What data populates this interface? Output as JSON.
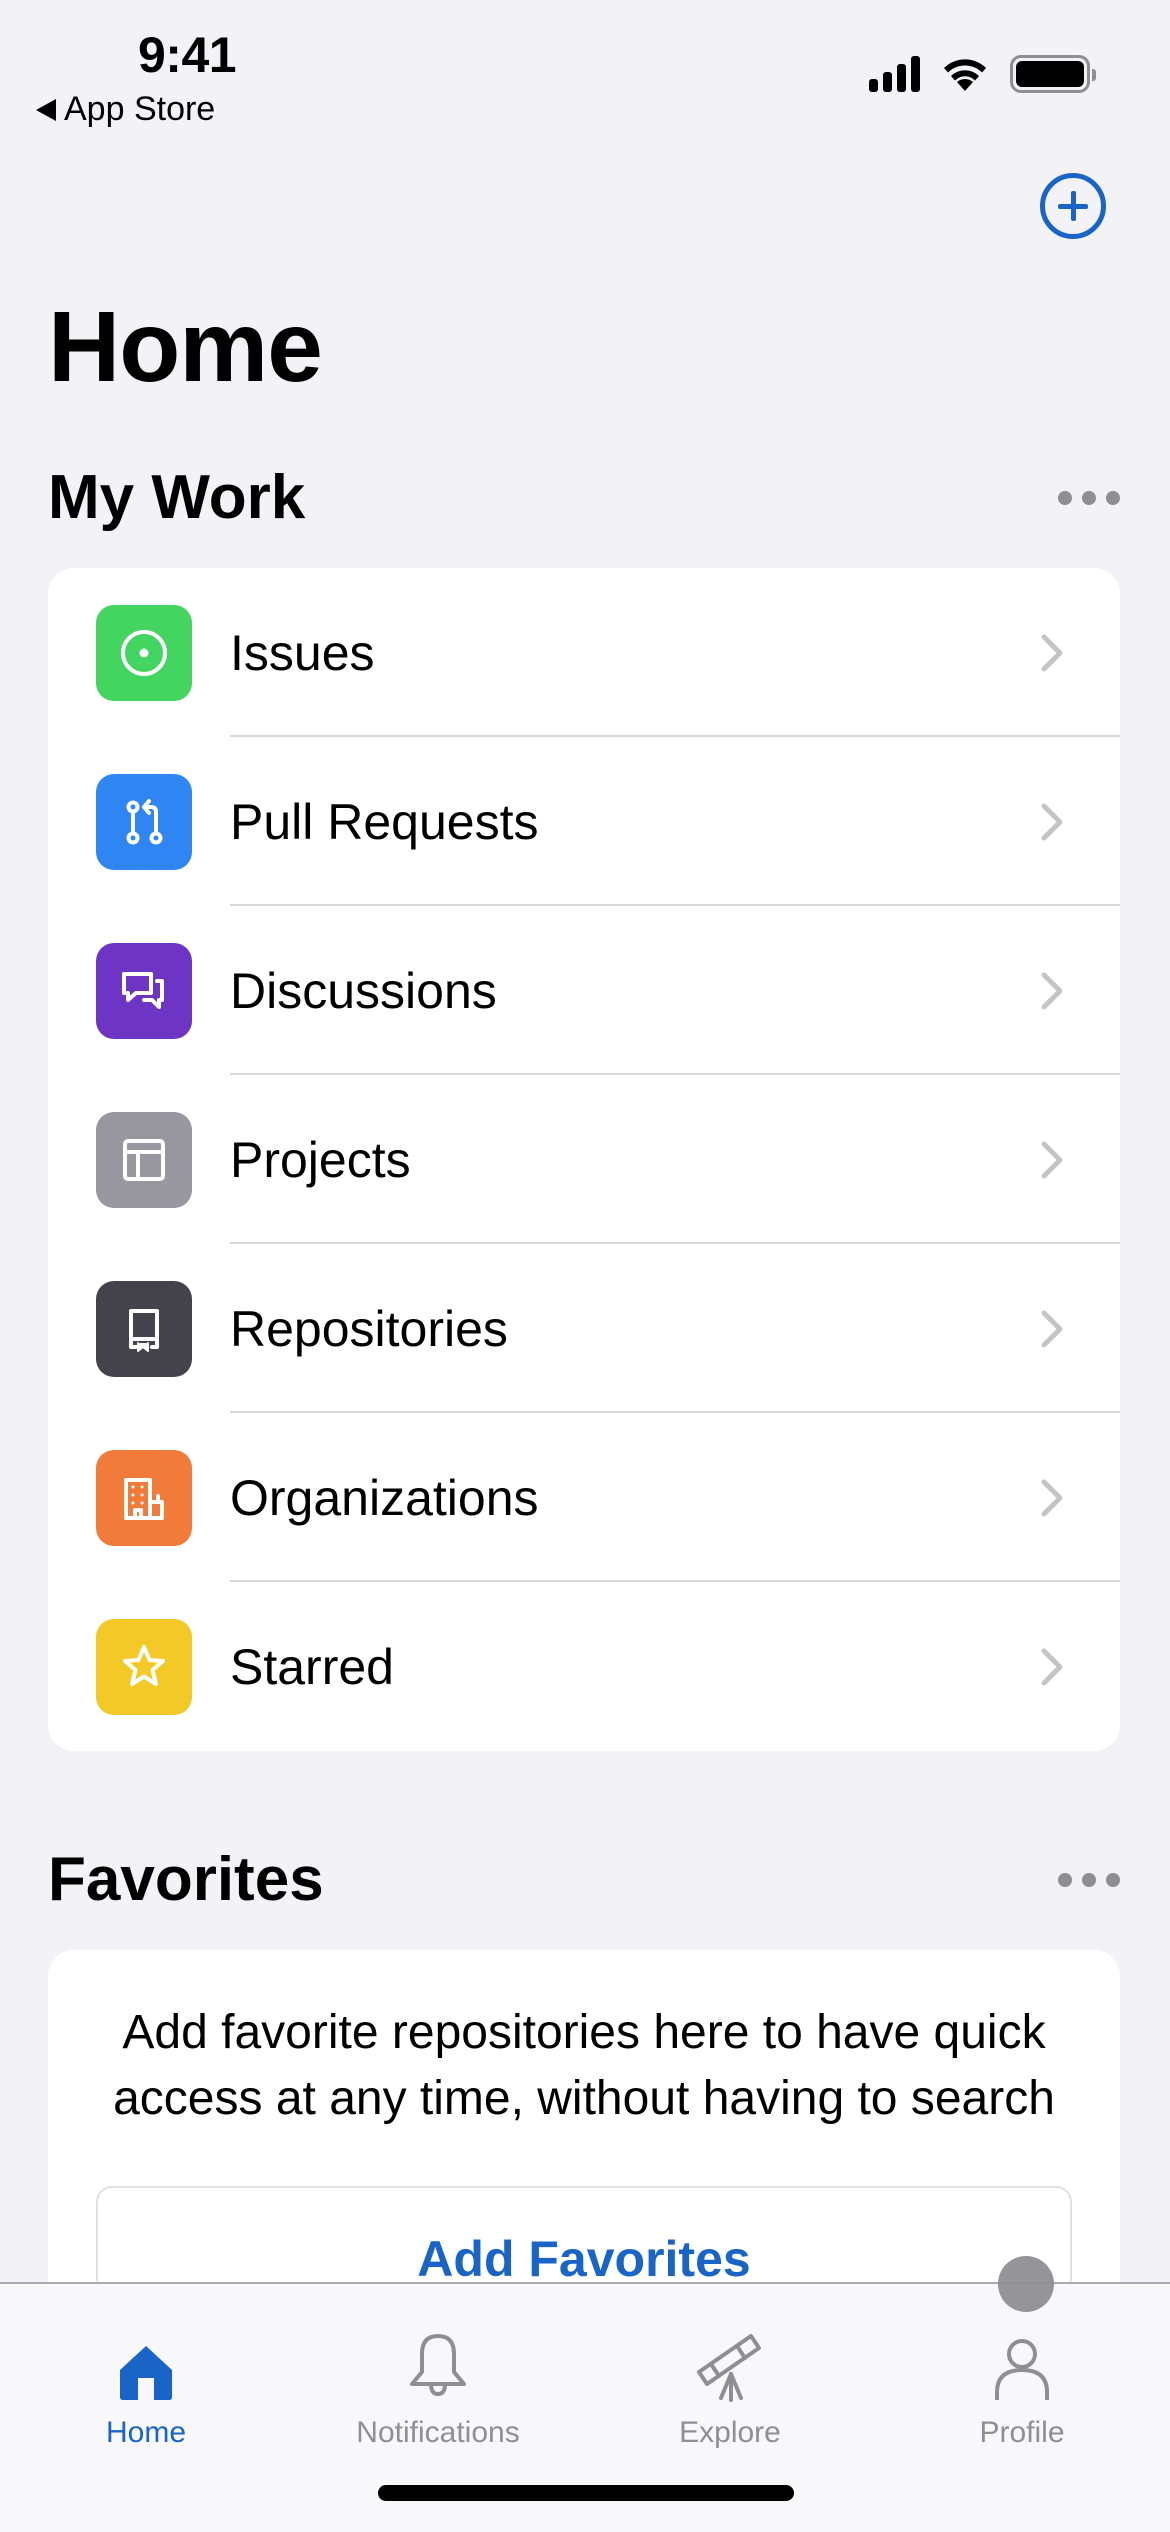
{
  "status_bar": {
    "time": "9:41",
    "back_label": "App Store",
    "signal_icon": "cellular-signal-icon",
    "wifi_icon": "wifi-icon",
    "battery_icon": "battery-full-icon"
  },
  "header": {
    "add_icon": "plus-circle-icon",
    "title": "Home"
  },
  "my_work": {
    "title": "My Work",
    "more_icon": "ellipsis-icon",
    "items": [
      {
        "label": "Issues",
        "icon": "issue-opened-icon",
        "color": "#44d561"
      },
      {
        "label": "Pull Requests",
        "icon": "git-pull-request-icon",
        "color": "#2f85f2"
      },
      {
        "label": "Discussions",
        "icon": "comment-discussion-icon",
        "color": "#6e35c4"
      },
      {
        "label": "Projects",
        "icon": "project-table-icon",
        "color": "#98979f"
      },
      {
        "label": "Repositories",
        "icon": "repo-icon",
        "color": "#44434c"
      },
      {
        "label": "Organizations",
        "icon": "organization-icon",
        "color": "#f07b3a"
      },
      {
        "label": "Starred",
        "icon": "star-icon",
        "color": "#f2c926"
      }
    ]
  },
  "favorites": {
    "title": "Favorites",
    "more_icon": "ellipsis-icon",
    "empty_text": "Add favorite repositories here to have quick access at any time, without having to search",
    "button_label": "Add Favorites"
  },
  "tab_bar": {
    "tabs": [
      {
        "label": "Home",
        "icon": "home-fill-icon",
        "active": true
      },
      {
        "label": "Notifications",
        "icon": "bell-icon",
        "active": false
      },
      {
        "label": "Explore",
        "icon": "telescope-icon",
        "active": false
      },
      {
        "label": "Profile",
        "icon": "person-icon",
        "active": false
      }
    ]
  },
  "colors": {
    "accent": "#1a64c8",
    "background": "#f2f2f7",
    "secondary_text": "#8e8e93"
  }
}
